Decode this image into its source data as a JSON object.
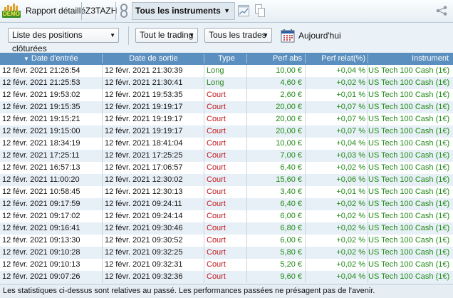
{
  "toolbar": {
    "logo_text": "DEMO",
    "report_tab": "Rapport détaillé",
    "account": "Z3TAZH",
    "instruments": "Tous les instruments"
  },
  "filters": {
    "positions": "Liste des positions clôturées",
    "trading": "Tout le trading",
    "trades": "Tous les trades",
    "period": "Aujourd'hui"
  },
  "columns": [
    "Date d'entrée",
    "Date de sortie",
    "Type",
    "Perf abs",
    "Perf relat(%)",
    "Instrument"
  ],
  "sort_indicator": "▼",
  "rows": [
    {
      "entry": "12 févr. 2021 21:26:54",
      "exit": "12 févr. 2021 21:30:39",
      "type": "Long",
      "abs": "10,00 €",
      "rel": "+0,04 %",
      "instrument": "US Tech 100 Cash (1€)"
    },
    {
      "entry": "12 févr. 2021 21:25:53",
      "exit": "12 févr. 2021 21:30:41",
      "type": "Long",
      "abs": "4,60 €",
      "rel": "+0,02 %",
      "instrument": "US Tech 100 Cash (1€)"
    },
    {
      "entry": "12 févr. 2021 19:53:02",
      "exit": "12 févr. 2021 19:53:35",
      "type": "Court",
      "abs": "2,60 €",
      "rel": "+0,01 %",
      "instrument": "US Tech 100 Cash (1€)"
    },
    {
      "entry": "12 févr. 2021 19:15:35",
      "exit": "12 févr. 2021 19:19:17",
      "type": "Court",
      "abs": "20,00 €",
      "rel": "+0,07 %",
      "instrument": "US Tech 100 Cash (1€)"
    },
    {
      "entry": "12 févr. 2021 19:15:21",
      "exit": "12 févr. 2021 19:19:17",
      "type": "Court",
      "abs": "20,00 €",
      "rel": "+0,07 %",
      "instrument": "US Tech 100 Cash (1€)"
    },
    {
      "entry": "12 févr. 2021 19:15:00",
      "exit": "12 févr. 2021 19:19:17",
      "type": "Court",
      "abs": "20,00 €",
      "rel": "+0,07 %",
      "instrument": "US Tech 100 Cash (1€)"
    },
    {
      "entry": "12 févr. 2021 18:34:19",
      "exit": "12 févr. 2021 18:41:04",
      "type": "Court",
      "abs": "10,00 €",
      "rel": "+0,04 %",
      "instrument": "US Tech 100 Cash (1€)"
    },
    {
      "entry": "12 févr. 2021 17:25:11",
      "exit": "12 févr. 2021 17:25:25",
      "type": "Court",
      "abs": "7,00 €",
      "rel": "+0,03 %",
      "instrument": "US Tech 100 Cash (1€)"
    },
    {
      "entry": "12 févr. 2021 16:57:13",
      "exit": "12 févr. 2021 17:06:57",
      "type": "Court",
      "abs": "6,40 €",
      "rel": "+0,02 %",
      "instrument": "US Tech 100 Cash (1€)"
    },
    {
      "entry": "12 févr. 2021 11:00:20",
      "exit": "12 févr. 2021 12:30:02",
      "type": "Court",
      "abs": "15,60 €",
      "rel": "+0,06 %",
      "instrument": "US Tech 100 Cash (1€)"
    },
    {
      "entry": "12 févr. 2021 10:58:45",
      "exit": "12 févr. 2021 12:30:13",
      "type": "Court",
      "abs": "3,40 €",
      "rel": "+0,01 %",
      "instrument": "US Tech 100 Cash (1€)"
    },
    {
      "entry": "12 févr. 2021 09:17:59",
      "exit": "12 févr. 2021 09:24:11",
      "type": "Court",
      "abs": "6,40 €",
      "rel": "+0,02 %",
      "instrument": "US Tech 100 Cash (1€)"
    },
    {
      "entry": "12 févr. 2021 09:17:02",
      "exit": "12 févr. 2021 09:24:14",
      "type": "Court",
      "abs": "6,00 €",
      "rel": "+0,02 %",
      "instrument": "US Tech 100 Cash (1€)"
    },
    {
      "entry": "12 févr. 2021 09:16:41",
      "exit": "12 févr. 2021 09:30:46",
      "type": "Court",
      "abs": "6,80 €",
      "rel": "+0,02 %",
      "instrument": "US Tech 100 Cash (1€)"
    },
    {
      "entry": "12 févr. 2021 09:13:30",
      "exit": "12 févr. 2021 09:30:52",
      "type": "Court",
      "abs": "6,00 €",
      "rel": "+0,02 %",
      "instrument": "US Tech 100 Cash (1€)"
    },
    {
      "entry": "12 févr. 2021 09:10:28",
      "exit": "12 févr. 2021 09:32:25",
      "type": "Court",
      "abs": "5,80 €",
      "rel": "+0,02 %",
      "instrument": "US Tech 100 Cash (1€)"
    },
    {
      "entry": "12 févr. 2021 09:10:13",
      "exit": "12 févr. 2021 09:32:31",
      "type": "Court",
      "abs": "5,20 €",
      "rel": "+0,02 %",
      "instrument": "US Tech 100 Cash (1€)"
    },
    {
      "entry": "12 févr. 2021 09:07:26",
      "exit": "12 févr. 2021 09:32:36",
      "type": "Court",
      "abs": "9,60 €",
      "rel": "+0,04 %",
      "instrument": "US Tech 100 Cash (1€)"
    }
  ],
  "footer": "Les statistiques ci-dessus sont relatives au passé. Les performances passées ne présagent pas de l'avenir.",
  "colors": {
    "header": "#5b8fbf",
    "long": "#2b8a1f",
    "court": "#c2171c",
    "perf": "#1f8a14"
  }
}
